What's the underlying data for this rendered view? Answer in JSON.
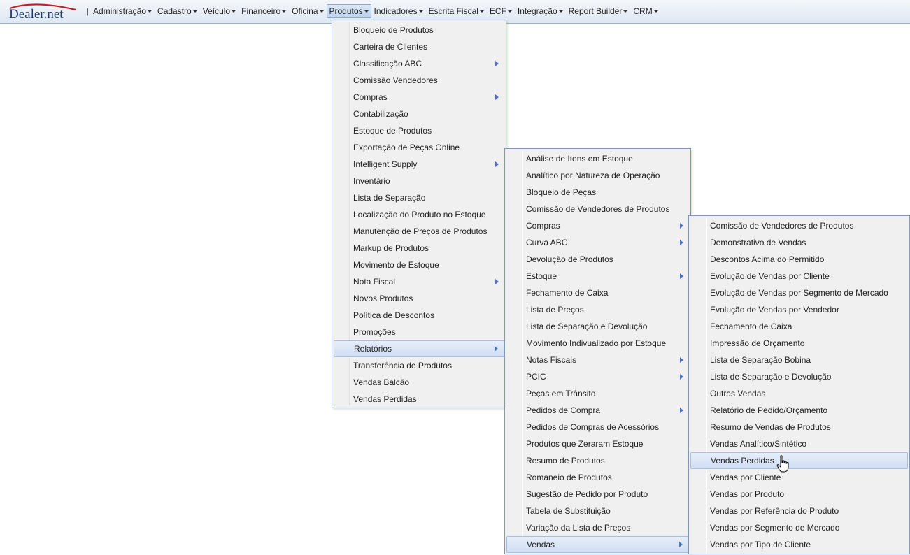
{
  "app": {
    "logo_text": "Dealer.net",
    "separator": "|"
  },
  "menubar": {
    "items": [
      {
        "label": "Administração"
      },
      {
        "label": "Cadastro"
      },
      {
        "label": "Veículo"
      },
      {
        "label": "Financeiro"
      },
      {
        "label": "Oficina"
      },
      {
        "label": "Produtos"
      },
      {
        "label": "Indicadores"
      },
      {
        "label": "Escrita Fiscal"
      },
      {
        "label": "ECF"
      },
      {
        "label": "Integração"
      },
      {
        "label": "Report Builder"
      },
      {
        "label": "CRM"
      }
    ],
    "active": "Produtos"
  },
  "produtos_menu": {
    "items": [
      {
        "label": "Bloqueio de Produtos"
      },
      {
        "label": "Carteira de Clientes"
      },
      {
        "label": "Classificação ABC",
        "submenu": true
      },
      {
        "label": "Comissão Vendedores"
      },
      {
        "label": "Compras",
        "submenu": true
      },
      {
        "label": "Contabilização"
      },
      {
        "label": "Estoque de Produtos"
      },
      {
        "label": "Exportação de Peças Online"
      },
      {
        "label": "Intelligent Supply",
        "submenu": true
      },
      {
        "label": "Inventário"
      },
      {
        "label": "Lista de Separação"
      },
      {
        "label": "Localização do Produto no Estoque"
      },
      {
        "label": "Manutenção de Preços de Produtos"
      },
      {
        "label": "Markup de Produtos"
      },
      {
        "label": "Movimento de Estoque"
      },
      {
        "label": "Nota Fiscal",
        "submenu": true
      },
      {
        "label": "Novos Produtos"
      },
      {
        "label": "Política de Descontos"
      },
      {
        "label": "Promoções"
      },
      {
        "label": "Relatórios",
        "submenu": true,
        "highlighted": true
      },
      {
        "label": "Transferência de Produtos"
      },
      {
        "label": "Vendas Balcão"
      },
      {
        "label": "Vendas Perdidas"
      }
    ]
  },
  "relatorios_menu": {
    "items": [
      {
        "label": "Análise de Itens em Estoque"
      },
      {
        "label": "Analítico por Natureza de Operação"
      },
      {
        "label": "Bloqueio de Peças"
      },
      {
        "label": "Comissão de Vendedores de Produtos"
      },
      {
        "label": "Compras",
        "submenu": true
      },
      {
        "label": "Curva ABC",
        "submenu": true
      },
      {
        "label": "Devolução de Produtos"
      },
      {
        "label": "Estoque",
        "submenu": true
      },
      {
        "label": "Fechamento de Caixa"
      },
      {
        "label": "Lista de Preços"
      },
      {
        "label": "Lista de Separação e Devolução"
      },
      {
        "label": "Movimento Indivualizado por Estoque"
      },
      {
        "label": "Notas Fiscais",
        "submenu": true
      },
      {
        "label": "PCIC",
        "submenu": true
      },
      {
        "label": "Peças em Trânsito"
      },
      {
        "label": "Pedidos de Compra",
        "submenu": true
      },
      {
        "label": "Pedidos de Compras de Acessórios"
      },
      {
        "label": "Produtos que Zeraram Estoque"
      },
      {
        "label": "Resumo de Produtos"
      },
      {
        "label": "Romaneio de Produtos"
      },
      {
        "label": "Sugestão de Pedido por Produto"
      },
      {
        "label": "Tabela de Substituição"
      },
      {
        "label": "Variação da Lista de Preços"
      },
      {
        "label": "Vendas",
        "submenu": true,
        "highlighted": true
      }
    ]
  },
  "vendas_menu": {
    "items": [
      {
        "label": "Comissão de Vendedores de Produtos"
      },
      {
        "label": "Demonstrativo de Vendas"
      },
      {
        "label": "Descontos Acima do Permitido"
      },
      {
        "label": "Evolução de Vendas por Cliente"
      },
      {
        "label": "Evolução de Vendas por Segmento de Mercado"
      },
      {
        "label": "Evolução de Vendas por Vendedor"
      },
      {
        "label": "Fechamento de Caixa"
      },
      {
        "label": "Impressão de Orçamento"
      },
      {
        "label": "Lista de Separação Bobina"
      },
      {
        "label": "Lista de Separação e Devolução"
      },
      {
        "label": "Outras Vendas"
      },
      {
        "label": "Relatório de Pedido/Orçamento"
      },
      {
        "label": "Resumo de Vendas de Produtos"
      },
      {
        "label": "Vendas Analítico/Sintético"
      },
      {
        "label": "Vendas Perdidas",
        "highlighted": true
      },
      {
        "label": "Vendas por Cliente"
      },
      {
        "label": "Vendas por Produto"
      },
      {
        "label": "Vendas por Referência do Produto"
      },
      {
        "label": "Vendas por Segmento de Mercado"
      },
      {
        "label": "Vendas por Tipo de Cliente"
      }
    ]
  },
  "colors": {
    "accent": "#4a78b8",
    "menu_bg": "#f0f0f0",
    "highlight_border": "#a7bfe0"
  },
  "icons": {
    "submenu": "arrow-right-icon",
    "cursor": "hand-pointer-icon"
  }
}
